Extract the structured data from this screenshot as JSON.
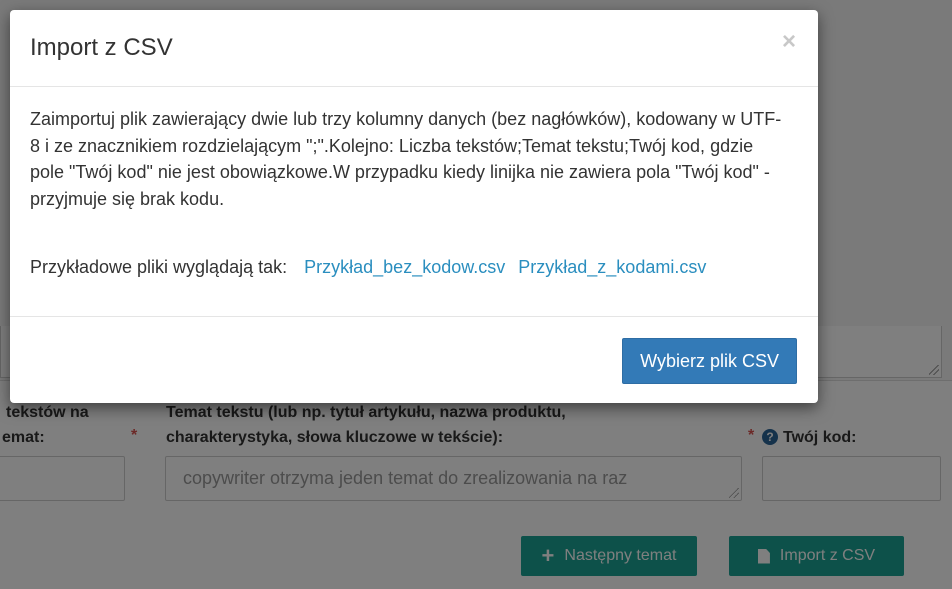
{
  "modal": {
    "title": "Import z CSV",
    "close_glyph": "×",
    "description": "Zaimportuj plik zawierający dwie lub trzy kolumny danych (bez nagłówków), kodowany w UTF-8 i ze znacznikiem rozdzielającym \";\".Kolejno: Liczba tekstów;Temat tekstu;Twój kod, gdzie pole \"Twój kod\" nie jest obowiązkowe.W przypadku kiedy linijka nie zawiera pola \"Twój kod\" - przyjmuje się brak kodu.",
    "examples_label": "Przykładowe pliki wyglądają tak:",
    "example_links": [
      "Przykład_bez_kodow.csv",
      "Przykład_z_kodami.csv"
    ],
    "choose_button": "Wybierz plik CSV"
  },
  "form": {
    "count_label_line1": "tekstów na",
    "count_label_line2": "emat:",
    "required_mark": "*",
    "topic_label_line1": "Temat tekstu (lub np. tytuł artykułu, nazwa produktu,",
    "topic_label_line2": "charakterystyka, słowa kluczowe w tekście):",
    "topic_placeholder": "copywriter otrzyma jeden temat do zrealizowania na raz",
    "code_label": "Twój kod:",
    "help_glyph": "?"
  },
  "actions": {
    "next_topic": "Następny temat",
    "import_csv": "Import z CSV"
  },
  "colors": {
    "teal": "#1aa394",
    "primary": "#337ab7",
    "link": "#2a8ebf",
    "required": "#d9534f"
  }
}
